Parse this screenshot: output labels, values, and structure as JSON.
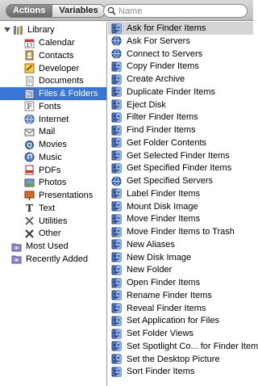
{
  "toolbar": {
    "actions_label": "Actions",
    "variables_label": "Variables",
    "search_placeholder": "Name"
  },
  "library": {
    "label": "Library",
    "items": [
      {
        "label": "Calendar",
        "icon": "calendar-icon"
      },
      {
        "label": "Contacts",
        "icon": "contacts-icon"
      },
      {
        "label": "Developer",
        "icon": "developer-icon"
      },
      {
        "label": "Documents",
        "icon": "documents-icon"
      },
      {
        "label": "Files & Folders",
        "icon": "files-folders-icon",
        "selected": true
      },
      {
        "label": "Fonts",
        "icon": "fonts-icon"
      },
      {
        "label": "Internet",
        "icon": "internet-icon"
      },
      {
        "label": "Mail",
        "icon": "mail-icon"
      },
      {
        "label": "Movies",
        "icon": "movies-icon"
      },
      {
        "label": "Music",
        "icon": "music-icon"
      },
      {
        "label": "PDFs",
        "icon": "pdfs-icon"
      },
      {
        "label": "Photos",
        "icon": "photos-icon"
      },
      {
        "label": "Presentations",
        "icon": "presentations-icon"
      },
      {
        "label": "Text",
        "icon": "text-icon"
      },
      {
        "label": "Utilities",
        "icon": "utilities-icon"
      },
      {
        "label": "Other",
        "icon": "other-icon"
      }
    ],
    "smart_groups": [
      {
        "label": "Most Used",
        "icon": "smart-folder-icon"
      },
      {
        "label": "Recently Added",
        "icon": "smart-folder-icon"
      }
    ]
  },
  "actions": [
    {
      "label": "Ask for Finder Items",
      "icon": "finder-icon",
      "selected": true
    },
    {
      "label": "Ask For Servers",
      "icon": "server-icon"
    },
    {
      "label": "Connect to Servers",
      "icon": "server-icon"
    },
    {
      "label": "Copy Finder Items",
      "icon": "finder-icon"
    },
    {
      "label": "Create Archive",
      "icon": "finder-icon"
    },
    {
      "label": "Duplicate Finder Items",
      "icon": "finder-icon"
    },
    {
      "label": "Eject Disk",
      "icon": "finder-icon"
    },
    {
      "label": "Filter Finder Items",
      "icon": "finder-icon"
    },
    {
      "label": "Find Finder Items",
      "icon": "finder-icon"
    },
    {
      "label": "Get Folder Contents",
      "icon": "finder-icon"
    },
    {
      "label": "Get Selected Finder Items",
      "icon": "finder-icon"
    },
    {
      "label": "Get Specified Finder Items",
      "icon": "finder-icon"
    },
    {
      "label": "Get Specified Servers",
      "icon": "server-icon"
    },
    {
      "label": "Label Finder Items",
      "icon": "finder-icon"
    },
    {
      "label": "Mount Disk Image",
      "icon": "finder-icon"
    },
    {
      "label": "Move Finder Items",
      "icon": "finder-icon"
    },
    {
      "label": "Move Finder Items to Trash",
      "icon": "finder-icon"
    },
    {
      "label": "New Aliases",
      "icon": "finder-icon"
    },
    {
      "label": "New Disk Image",
      "icon": "finder-icon"
    },
    {
      "label": "New Folder",
      "icon": "finder-icon"
    },
    {
      "label": "Open Finder Items",
      "icon": "finder-icon"
    },
    {
      "label": "Rename Finder Items",
      "icon": "finder-icon"
    },
    {
      "label": "Reveal Finder Items",
      "icon": "finder-icon"
    },
    {
      "label": "Set Application for Files",
      "icon": "finder-icon"
    },
    {
      "label": "Set Folder Views",
      "icon": "finder-icon"
    },
    {
      "label": "Set Spotlight Co... for Finder Items",
      "icon": "finder-icon"
    },
    {
      "label": "Set the Desktop Picture",
      "icon": "finder-icon"
    },
    {
      "label": "Sort Finder Items",
      "icon": "finder-icon"
    }
  ],
  "colors": {
    "selection_blue": "#3875d7",
    "selection_gray": "#d4d4d4",
    "toolbar_bg": "#c8c8c8"
  }
}
